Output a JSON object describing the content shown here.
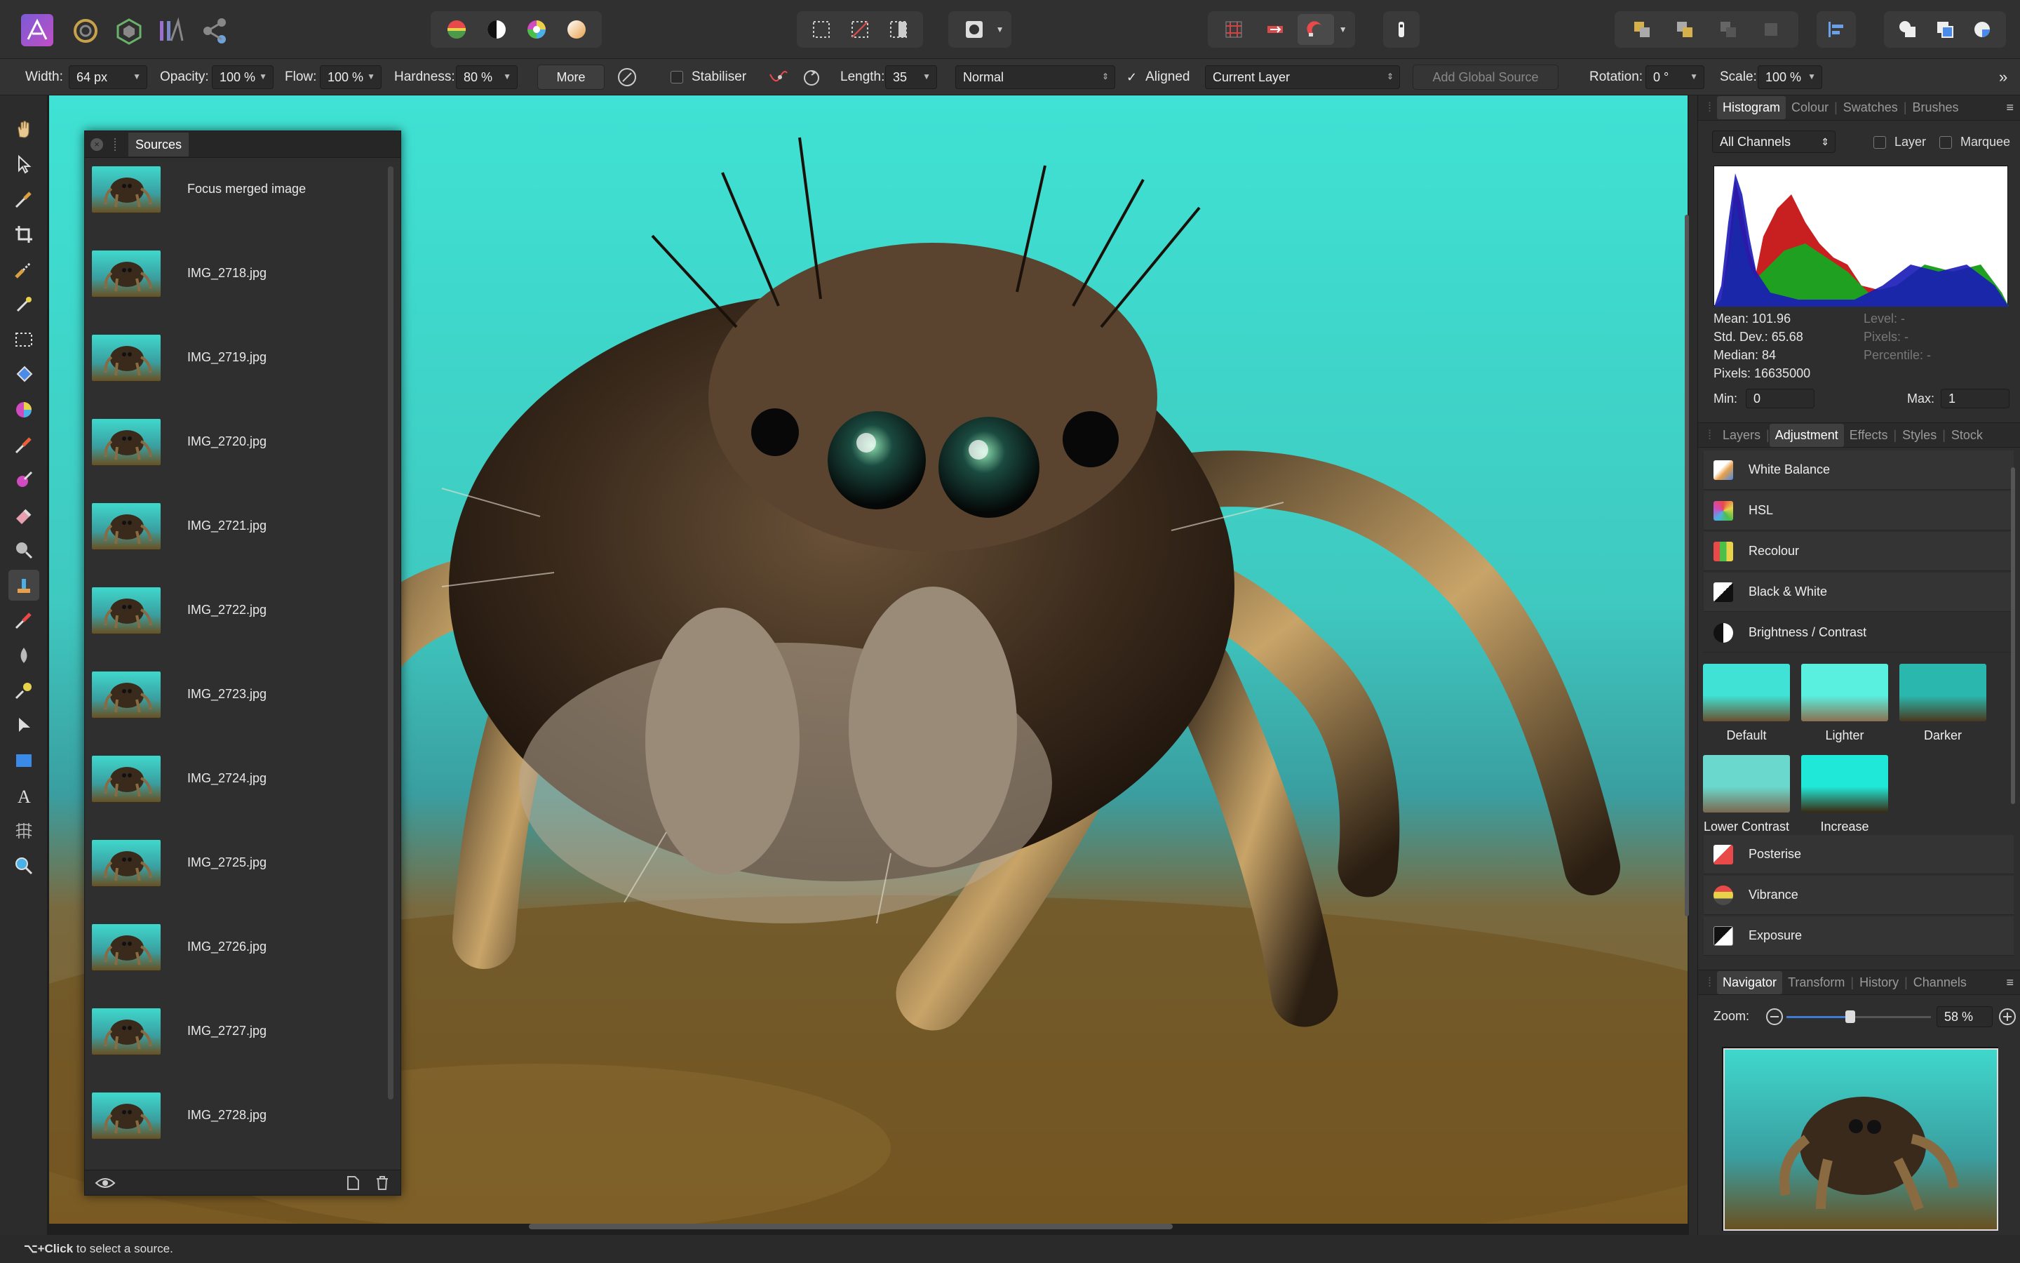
{
  "toolbar": {
    "brush": {
      "width_label": "Width:",
      "width_value": "64 px",
      "opacity_label": "Opacity:",
      "opacity_value": "100 %",
      "flow_label": "Flow:",
      "flow_value": "100 %",
      "hardness_label": "Hardness:",
      "hardness_value": "80 %"
    },
    "more_label": "More",
    "stabiliser_label": "Stabiliser",
    "length_label": "Length:",
    "length_value": "35",
    "blend_mode": "Normal",
    "aligned_label": "Aligned",
    "source_layer": "Current Layer",
    "add_global_source": "Add Global Source",
    "rotation_label": "Rotation:",
    "rotation_value": "0 °",
    "scale_label": "Scale:",
    "scale_value": "100 %"
  },
  "sources_panel": {
    "title": "Sources",
    "items": [
      "Focus merged image",
      "IMG_2718.jpg",
      "IMG_2719.jpg",
      "IMG_2720.jpg",
      "IMG_2721.jpg",
      "IMG_2722.jpg",
      "IMG_2723.jpg",
      "IMG_2724.jpg",
      "IMG_2725.jpg",
      "IMG_2726.jpg",
      "IMG_2727.jpg",
      "IMG_2728.jpg"
    ]
  },
  "histogram_panel": {
    "tabs": [
      "Histogram",
      "Colour",
      "Swatches",
      "Brushes"
    ],
    "active_tab": "Histogram",
    "channel": "All Channels",
    "layer_label": "Layer",
    "marquee_label": "Marquee",
    "stats": {
      "mean": "Mean: 101.96",
      "stddev": "Std. Dev.: 65.68",
      "median": "Median: 84",
      "pixels": "Pixels: 16635000",
      "level": "Level: -",
      "pixels_sel": "Pixels: -",
      "percentile": "Percentile: -"
    },
    "min_label": "Min:",
    "min_value": "0",
    "max_label": "Max:",
    "max_value": "1"
  },
  "adjustment_panel": {
    "tabs": [
      "Layers",
      "Adjustment",
      "Effects",
      "Styles",
      "Stock"
    ],
    "active_tab": "Adjustment",
    "items": [
      "White Balance",
      "HSL",
      "Recolour",
      "Black & White",
      "Brightness / Contrast"
    ],
    "presets": [
      "Default",
      "Lighter",
      "Darker",
      "Lower Contrast",
      "Increase Contr..."
    ],
    "items_after": [
      "Posterise",
      "Vibrance",
      "Exposure"
    ]
  },
  "navigator_panel": {
    "tabs": [
      "Navigator",
      "Transform",
      "History",
      "Channels"
    ],
    "active_tab": "Navigator",
    "zoom_label": "Zoom:",
    "zoom_value": "58 %"
  },
  "status_bar": {
    "key": "⌥+Click",
    "text": " to select a source."
  },
  "colors": {
    "accent": "#3d7bd6",
    "canvas_bg": "#40d8c8",
    "panel": "#2e2e2e"
  }
}
